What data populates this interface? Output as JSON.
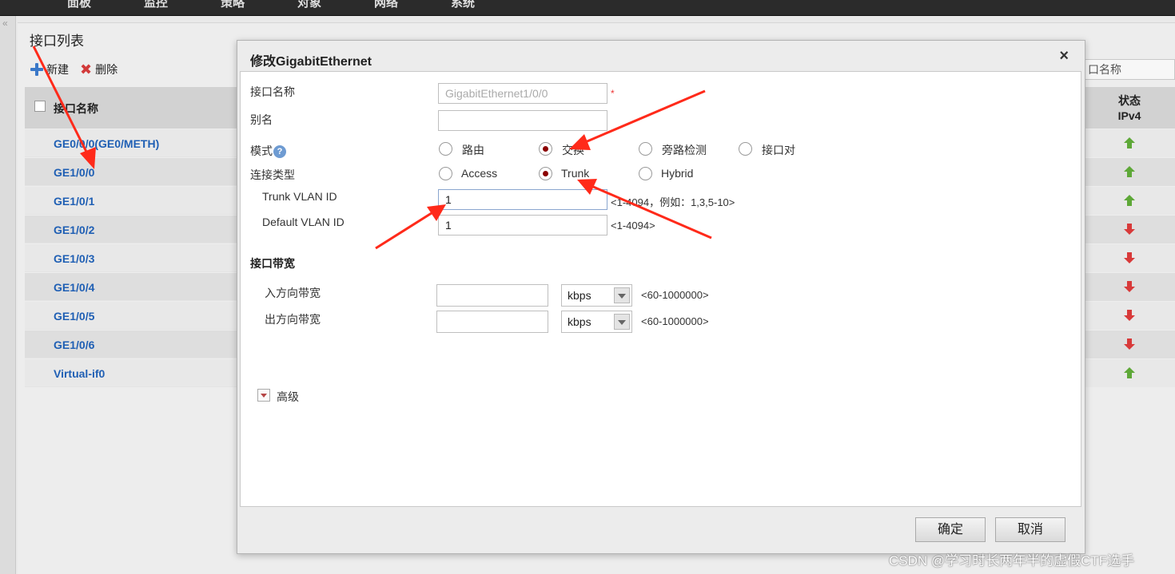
{
  "topnav": {
    "items": [
      "面板",
      "监控",
      "策略",
      "对象",
      "网络",
      "系统"
    ]
  },
  "page": {
    "title": "接口列表",
    "toolbar": {
      "new_label": "新建",
      "delete_label": "删除"
    },
    "list_header": "接口名称",
    "interfaces": [
      {
        "name": "GE0/0/0(GE0/METH)",
        "ipv4_status": "up"
      },
      {
        "name": "GE1/0/0",
        "ipv4_status": "up"
      },
      {
        "name": "GE1/0/1",
        "ipv4_status": "up"
      },
      {
        "name": "GE1/0/2",
        "ipv4_status": "down"
      },
      {
        "name": "GE1/0/3",
        "ipv4_status": "down"
      },
      {
        "name": "GE1/0/4",
        "ipv4_status": "down"
      },
      {
        "name": "GE1/0/5",
        "ipv4_status": "down"
      },
      {
        "name": "GE1/0/6",
        "ipv4_status": "down"
      },
      {
        "name": "Virtual-if0",
        "ipv4_status": "up"
      }
    ],
    "search_placeholder": "口名称",
    "status_header": {
      "line1": "状态",
      "line2": "IPv4"
    }
  },
  "dialog": {
    "title": "修改GigabitEthernet",
    "close": "×",
    "fields": {
      "name_label": "接口名称",
      "name_value": "GigabitEthernet1/0/0",
      "required_mark": "*",
      "alias_label": "别名",
      "alias_value": "",
      "mode_label": "模式",
      "help": "?",
      "mode_options": [
        "路由",
        "交换",
        "旁路检测",
        "接口对"
      ],
      "mode_selected": "交换",
      "conn_label": "连接类型",
      "conn_options": [
        "Access",
        "Trunk",
        "Hybrid"
      ],
      "conn_selected": "Trunk",
      "trunk_vlan_label": "Trunk VLAN ID",
      "trunk_vlan_value": "1",
      "trunk_vlan_hint": "<1-4094，例如：1,3,5-10>",
      "default_vlan_label": "Default VLAN ID",
      "default_vlan_value": "1",
      "default_vlan_hint": "<1-4094>"
    },
    "bandwidth": {
      "section_title": "接口带宽",
      "in_label": "入方向带宽",
      "in_value": "",
      "in_unit": "kbps",
      "in_hint": "<60-1000000>",
      "out_label": "出方向带宽",
      "out_value": "",
      "out_unit": "kbps",
      "out_hint": "<60-1000000>"
    },
    "advanced_label": "高级",
    "ok_label": "确定",
    "cancel_label": "取消"
  },
  "annotation_color": "#ff2a1a",
  "watermark": "CSDN @学习时长两年半的虚假CTF选手"
}
